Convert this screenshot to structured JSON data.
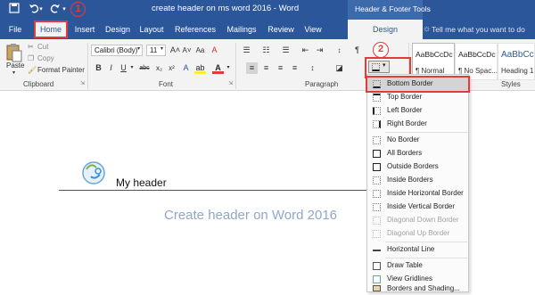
{
  "titlebar": {
    "title": "create header on ms word 2016  -  Word",
    "context_tools": "Header & Footer Tools",
    "step1": "1",
    "qat": [
      "save-icon",
      "undo-icon",
      "redo-icon"
    ]
  },
  "tabs": [
    {
      "label": "File"
    },
    {
      "label": "Home"
    },
    {
      "label": "Insert"
    },
    {
      "label": "Design"
    },
    {
      "label": "Layout"
    },
    {
      "label": "References"
    },
    {
      "label": "Mailings"
    },
    {
      "label": "Review"
    },
    {
      "label": "View"
    },
    {
      "label": "Design"
    }
  ],
  "tell_me": "Tell me what you want to do",
  "ribbon": {
    "clipboard": {
      "paste": "Paste",
      "cut": "Cut",
      "copy": "Copy",
      "format_painter": "Format Painter",
      "label": "Clipboard"
    },
    "font": {
      "name": "Calibri (Body)",
      "size": "11",
      "label": "Font",
      "bold": "B",
      "italic": "I",
      "underline": "U",
      "strike": "abc",
      "sub": "x₂",
      "sup": "x²",
      "color_a": "A",
      "grow": "A˄",
      "shrink": "A˅",
      "case": "Aa",
      "clear": "A"
    },
    "paragraph": {
      "label": "Paragraph",
      "pilcrow": "¶"
    },
    "styles": {
      "label": "Styles",
      "tiles": [
        {
          "sample": "AaBbCcDc",
          "name": "¶ Normal"
        },
        {
          "sample": "AaBbCcDc",
          "name": "¶ No Spac..."
        },
        {
          "sample": "AaBbCc",
          "name": "Heading 1"
        }
      ]
    },
    "step2": "2"
  },
  "document": {
    "header_text": "My header",
    "body_text": "Create header on Word 2016"
  },
  "menu": {
    "items": [
      {
        "label": "Bottom Border",
        "disabled": false
      },
      {
        "label": "Top Border",
        "disabled": false
      },
      {
        "label": "Left Border",
        "disabled": false
      },
      {
        "label": "Right Border",
        "disabled": false
      },
      {
        "label": "No Border",
        "disabled": false
      },
      {
        "label": "All Borders",
        "disabled": false
      },
      {
        "label": "Outside Borders",
        "disabled": false
      },
      {
        "label": "Inside Borders",
        "disabled": false
      },
      {
        "label": "Inside Horizontal Border",
        "disabled": false
      },
      {
        "label": "Inside Vertical Border",
        "disabled": false
      },
      {
        "label": "Diagonal Down Border",
        "disabled": true
      },
      {
        "label": "Diagonal Up Border",
        "disabled": true
      },
      {
        "label": "Horizontal Line",
        "disabled": false
      },
      {
        "label": "Draw Table",
        "disabled": false
      },
      {
        "label": "View Gridlines",
        "disabled": false
      },
      {
        "label": "Borders and Shading...",
        "disabled": false
      }
    ]
  },
  "colors": {
    "title_bar": "#2b579a",
    "highlight": "#e23b3b",
    "body_text": "#8fa8c8"
  }
}
